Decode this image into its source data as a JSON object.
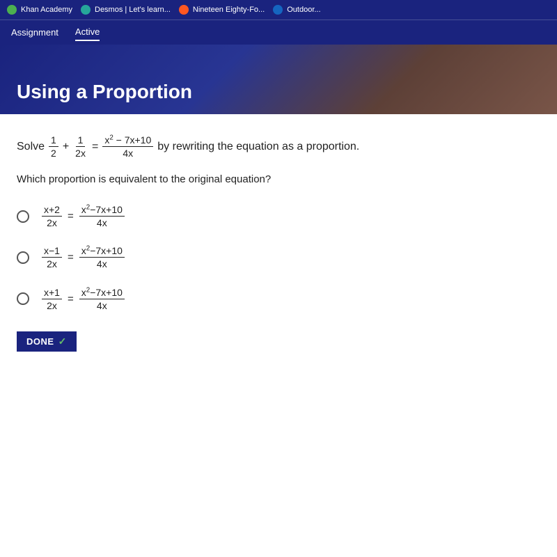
{
  "browser": {
    "tabs": [
      {
        "label": "Khan Academy",
        "icon_color": "green"
      },
      {
        "label": "Desmos | Let's learn...",
        "icon_color": "teal"
      },
      {
        "label": "Nineteen Eighty-Fo...",
        "icon_color": "orange"
      },
      {
        "label": "Outdoor...",
        "icon_color": "blue"
      }
    ]
  },
  "nav": {
    "items": [
      {
        "label": "Assignment",
        "active": false
      },
      {
        "label": "Active",
        "active": true
      }
    ]
  },
  "hero": {
    "title": "Using a Proportion"
  },
  "problem": {
    "prefix": "Solve",
    "suffix": "by rewriting the equation as a proportion.",
    "question": "Which proportion is equivalent to the original equation?"
  },
  "choices": [
    {
      "id": "choice-a",
      "numerator_left": "x+2",
      "denominator_left": "2x",
      "numerator_right": "x²−7x+10",
      "denominator_right": "4x"
    },
    {
      "id": "choice-b",
      "numerator_left": "x−1",
      "denominator_left": "2x",
      "numerator_right": "x²−7x+10",
      "denominator_right": "4x"
    },
    {
      "id": "choice-c",
      "numerator_left": "x+1",
      "denominator_left": "2x",
      "numerator_right": "x²−7x+10",
      "denominator_right": "4x"
    }
  ],
  "done_button": {
    "label": "DONE"
  }
}
